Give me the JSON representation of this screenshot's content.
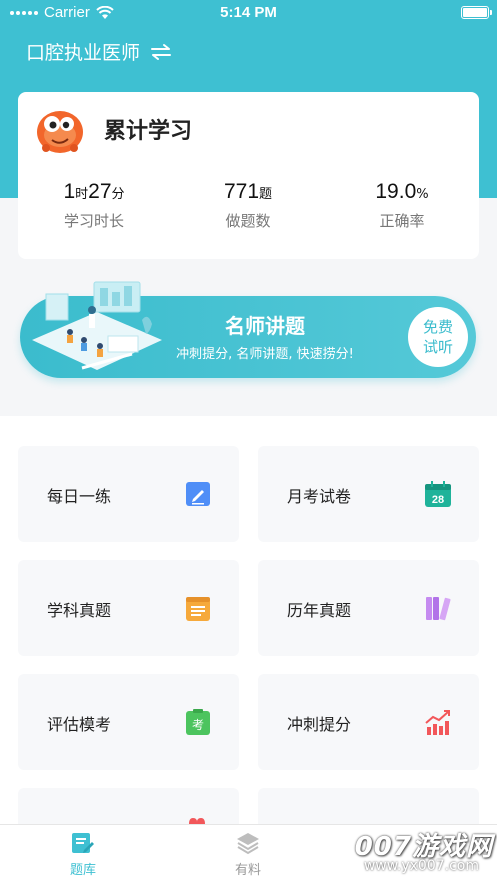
{
  "status_bar": {
    "carrier": "Carrier",
    "time": "5:14 PM"
  },
  "header": {
    "title": "口腔执业医师"
  },
  "stats_card": {
    "title": "累计学习",
    "stats": [
      {
        "value1": "1",
        "unit1": "时",
        "value2": "27",
        "unit2": "分",
        "label": "学习时长"
      },
      {
        "value": "771",
        "unit": "题",
        "label": "做题数"
      },
      {
        "value": "19.0",
        "unit": "%",
        "label": "正确率"
      }
    ]
  },
  "banner": {
    "title": "名师讲题",
    "subtitle": "冲刺提分, 名师讲题, 快速捞分!",
    "button_line1": "免费",
    "button_line2": "试听"
  },
  "tiles": [
    {
      "label": "每日一练",
      "icon": "pencil-note-icon",
      "color": "#4f8ef7"
    },
    {
      "label": "月考试卷",
      "icon": "calendar-28-icon",
      "color": "#1fb39a",
      "icon_text": "28"
    },
    {
      "label": "学科真题",
      "icon": "notepad-icon",
      "color": "#f6a93b"
    },
    {
      "label": "历年真题",
      "icon": "books-icon",
      "color": "#b273e8"
    },
    {
      "label": "评估模考",
      "icon": "exam-clipboard-icon",
      "color": "#4cc45e",
      "icon_text": "考"
    },
    {
      "label": "冲刺提分",
      "icon": "trend-chart-icon",
      "color": "#f2575a"
    }
  ],
  "tabbar": {
    "tabs": [
      {
        "label": "题库",
        "active": true,
        "color": "#3ec0d2"
      },
      {
        "label": "有料",
        "active": false,
        "color": "#999999"
      }
    ]
  },
  "watermark": {
    "line1": "007游戏网",
    "line2": "www.yx007.com"
  }
}
